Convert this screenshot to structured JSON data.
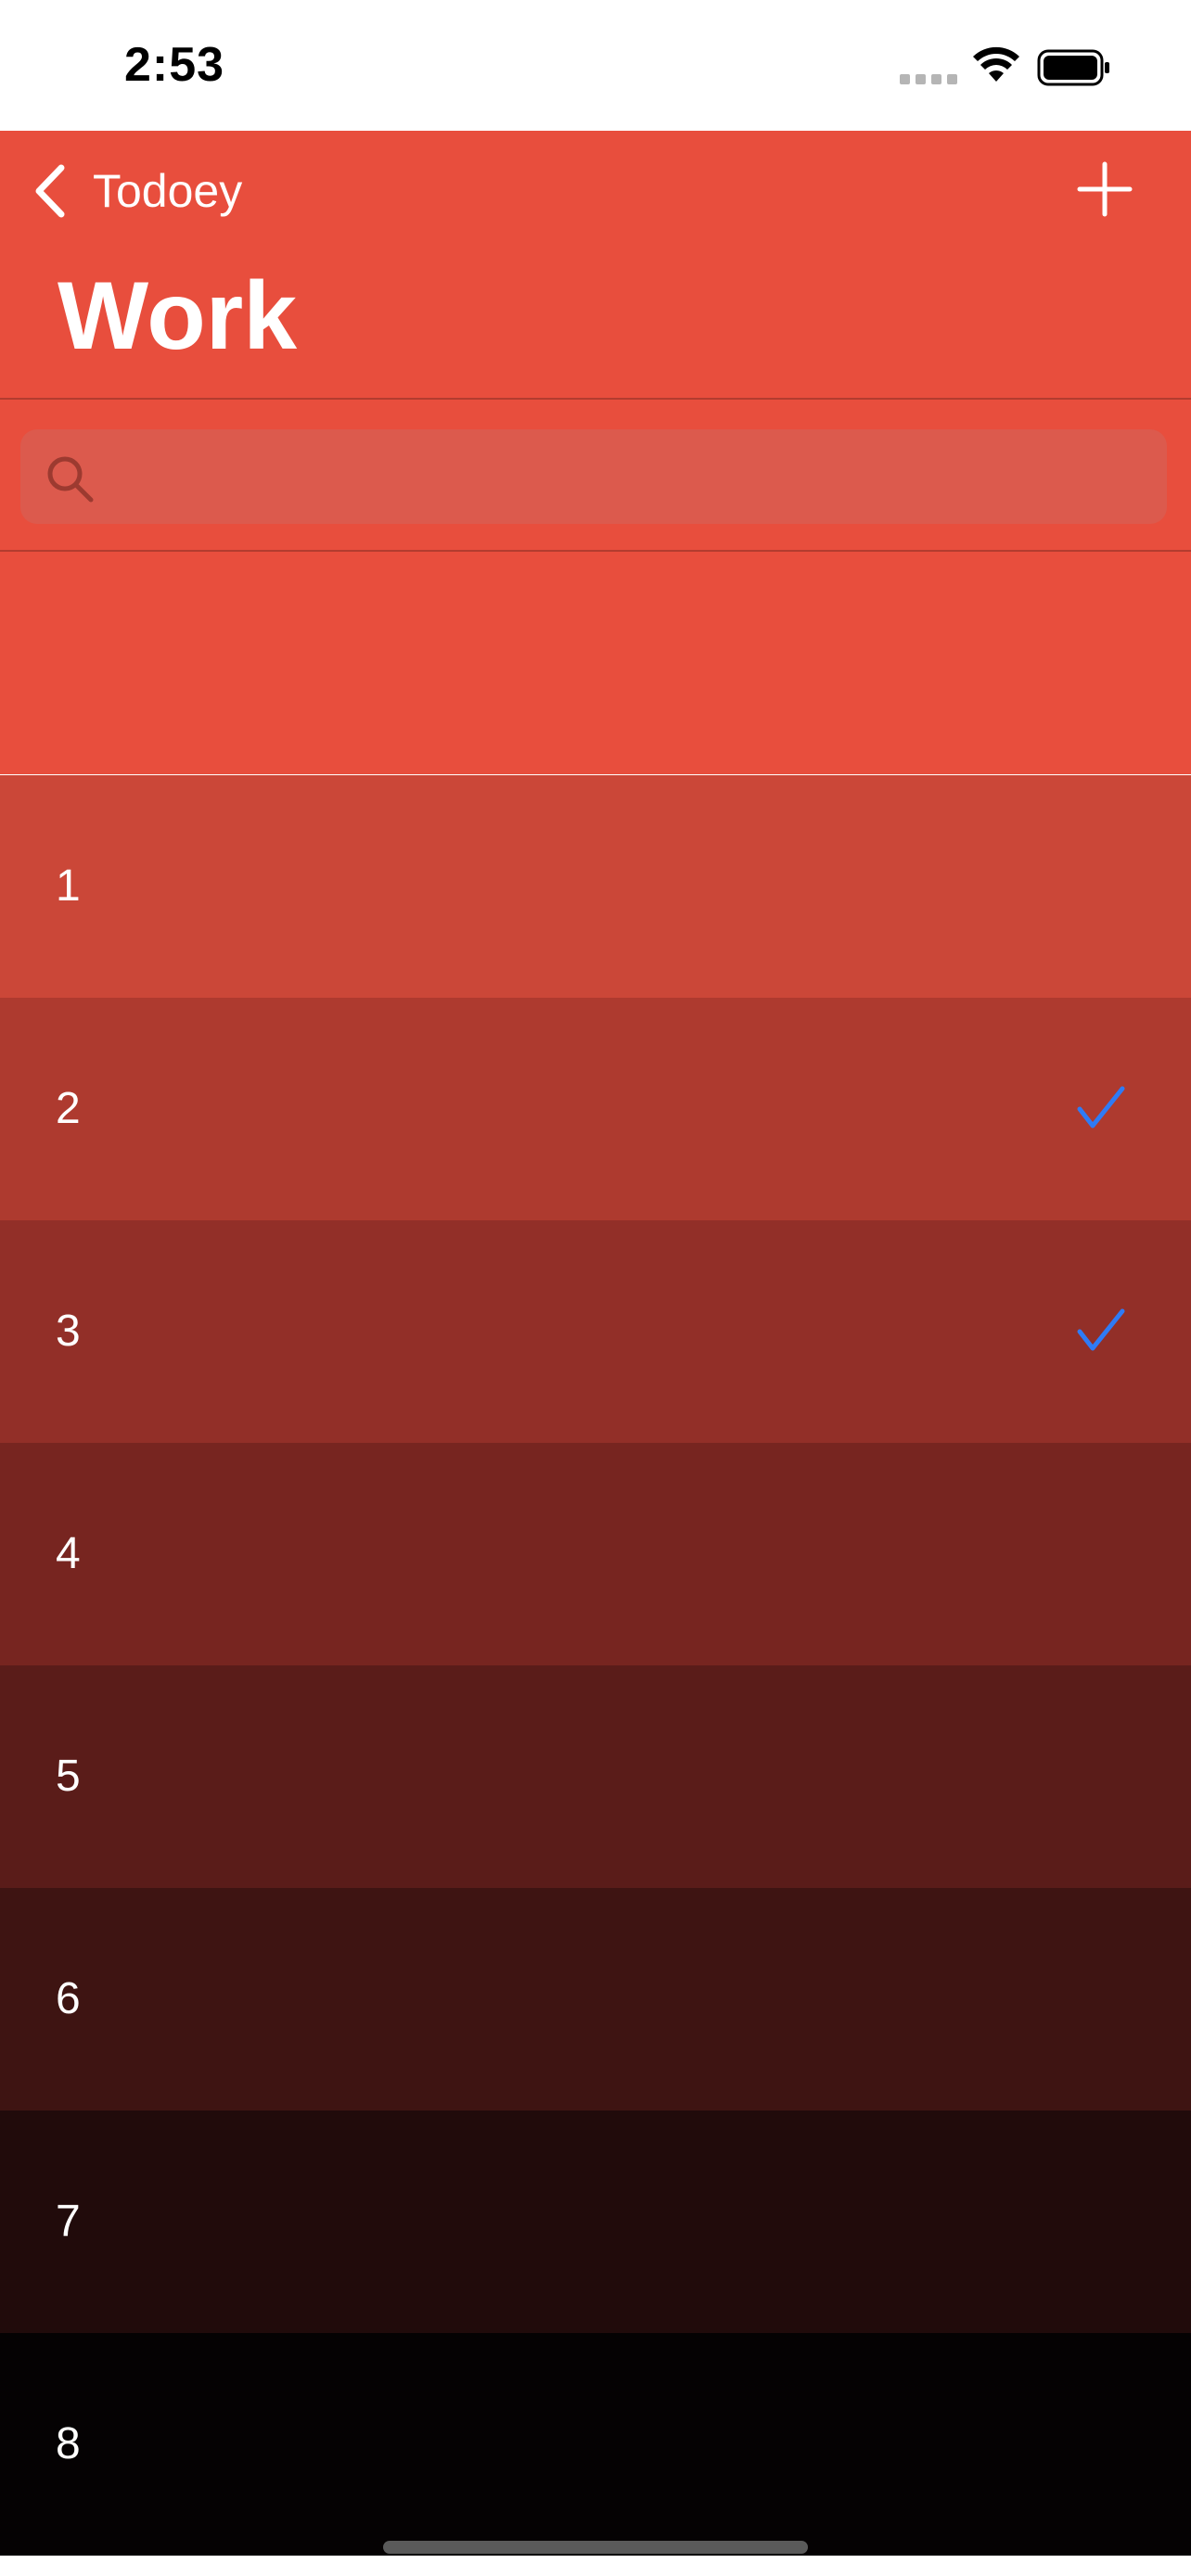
{
  "status_bar": {
    "time": "2:53"
  },
  "nav": {
    "back_label": "Todoey",
    "title": "Work",
    "back_icon": "chevron-left-icon",
    "add_icon": "plus-icon"
  },
  "search": {
    "placeholder": "",
    "value": "",
    "icon": "search-icon"
  },
  "items": [
    {
      "title": "1",
      "done": false,
      "color": "#cb4738"
    },
    {
      "title": "2",
      "done": true,
      "color": "#ae3a2f"
    },
    {
      "title": "3",
      "done": true,
      "color": "#922f28"
    },
    {
      "title": "4",
      "done": false,
      "color": "#772520"
    },
    {
      "title": "5",
      "done": false,
      "color": "#5a1c19"
    },
    {
      "title": "6",
      "done": false,
      "color": "#3e1412"
    },
    {
      "title": "7",
      "done": false,
      "color": "#210b0b"
    },
    {
      "title": "8",
      "done": false,
      "color": "#050203"
    }
  ],
  "colors": {
    "accent": "#e84e3d",
    "checkmark": "#2f7bf5"
  }
}
